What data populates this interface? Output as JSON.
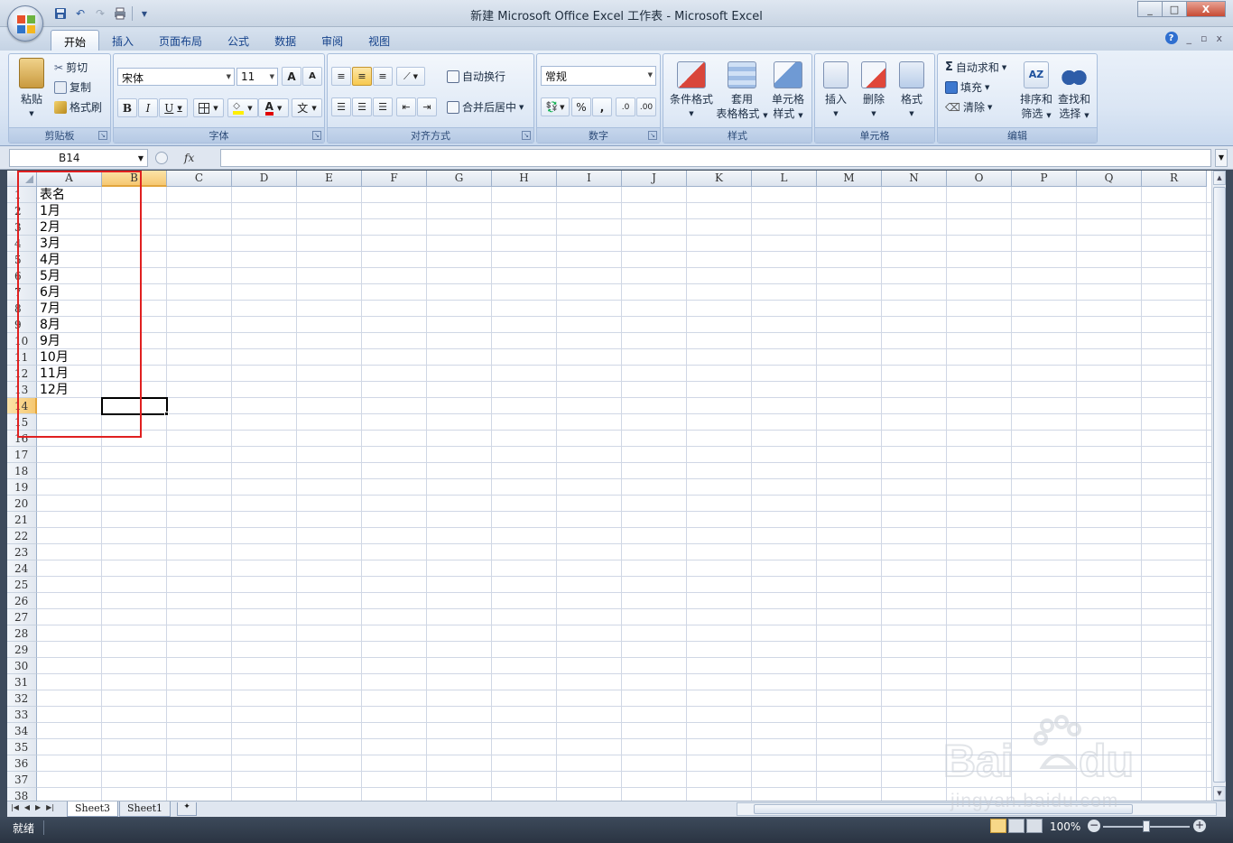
{
  "window": {
    "title": "新建 Microsoft Office Excel 工作表 - Microsoft Excel",
    "minimize": "_",
    "maximize": "□",
    "close": "X"
  },
  "qat": {
    "save": "save-icon",
    "undo": "undo-icon",
    "redo": "redo-icon",
    "print": "print-icon"
  },
  "tabs": [
    "开始",
    "插入",
    "页面布局",
    "公式",
    "数据",
    "审阅",
    "视图"
  ],
  "ribbon": {
    "clipboard": {
      "label": "剪贴板",
      "paste": "粘贴",
      "cut": "剪切",
      "copy": "复制",
      "format_painter": "格式刷"
    },
    "font": {
      "label": "字体",
      "name": "宋体",
      "size": "11",
      "bold": "B",
      "italic": "I",
      "underline": "U",
      "grow": "A",
      "shrink": "A",
      "font_color": "A",
      "phonetic": "文"
    },
    "alignment": {
      "label": "对齐方式",
      "wrap": "自动换行",
      "merge": "合并后居中"
    },
    "number": {
      "label": "数字",
      "format": "常规",
      "percent": "%",
      "comma": ",",
      "inc_dec": ".0",
      "dec_dec": ".00"
    },
    "styles": {
      "label": "样式",
      "conditional": "条件格式",
      "table_format_1": "套用",
      "table_format_2": "表格格式",
      "cell_style_1": "单元格",
      "cell_style_2": "样式"
    },
    "cells": {
      "label": "单元格",
      "insert": "插入",
      "delete": "删除",
      "format": "格式"
    },
    "editing": {
      "label": "编辑",
      "autosum": "自动求和",
      "fill": "填充",
      "clear": "清除",
      "sort_1": "排序和",
      "sort_2": "筛选",
      "find_1": "查找和",
      "find_2": "选择"
    }
  },
  "formula_bar": {
    "name_box": "B14",
    "fx": "fx",
    "value": ""
  },
  "columns": [
    "A",
    "B",
    "C",
    "D",
    "E",
    "F",
    "G",
    "H",
    "I",
    "J",
    "K",
    "L",
    "M",
    "N",
    "O",
    "P",
    "Q",
    "R"
  ],
  "rows": [
    "1",
    "2",
    "3",
    "4",
    "5",
    "6",
    "7",
    "8",
    "9",
    "10",
    "11",
    "12",
    "13",
    "14",
    "15",
    "16",
    "17",
    "18",
    "19",
    "20",
    "21",
    "22",
    "23",
    "24",
    "25",
    "26",
    "27",
    "28",
    "29",
    "30",
    "31",
    "32",
    "33",
    "34",
    "35",
    "36",
    "37",
    "38"
  ],
  "cells_col_a": [
    "表名",
    "1月",
    "2月",
    "3月",
    "4月",
    "5月",
    "6月",
    "7月",
    "8月",
    "9月",
    "10月",
    "11月",
    "12月"
  ],
  "selection": {
    "active_cell": "B14",
    "active_row": "14",
    "active_col": "B"
  },
  "sheets": [
    "Sheet3",
    "Sheet1"
  ],
  "status": {
    "ready": "就绪",
    "zoom": "100%"
  },
  "colors": {
    "highlight_box": "#e02020",
    "header_selected": "#f6c872",
    "gridline": "#d0d7e5"
  },
  "watermark": {
    "text_line": "jingyan.baidu.com"
  }
}
